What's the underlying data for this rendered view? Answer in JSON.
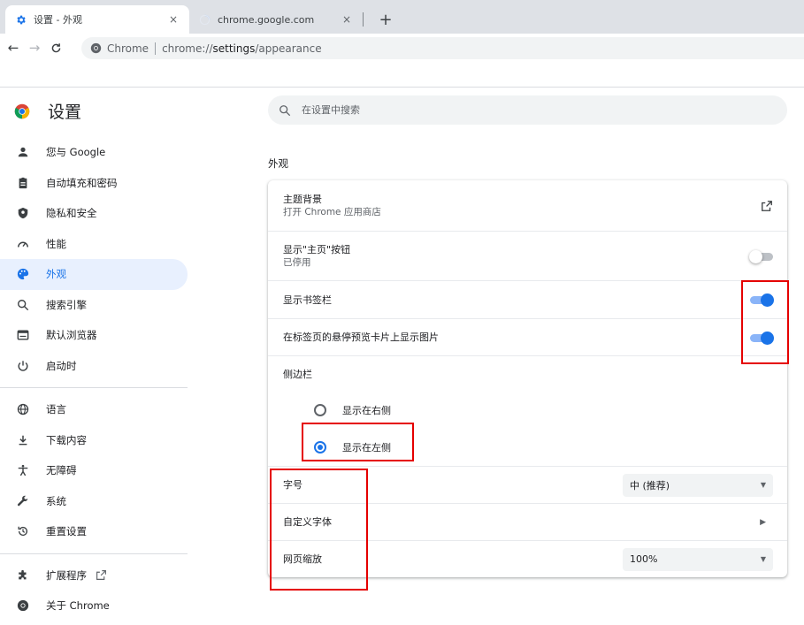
{
  "tabs": [
    {
      "title": "设置 - 外观",
      "active": true
    },
    {
      "title": "chrome.google.com",
      "active": false
    }
  ],
  "tab_close_glyph": "×",
  "new_tab_glyph": "+",
  "toolbar": {
    "back_glyph": "←",
    "forward_glyph": "→",
    "reload_glyph": "C",
    "chip": "Chrome",
    "url_prefix": "chrome://",
    "url_host": "settings",
    "url_path": "/appearance"
  },
  "brand": {
    "title": "设置"
  },
  "nav": {
    "group1": [
      {
        "label": "您与 Google",
        "icon": "person-icon"
      },
      {
        "label": "自动填充和密码",
        "icon": "clipboard-icon"
      },
      {
        "label": "隐私和安全",
        "icon": "shield-icon"
      },
      {
        "label": "性能",
        "icon": "speedometer-icon"
      },
      {
        "label": "外观",
        "icon": "palette-icon",
        "active": true
      },
      {
        "label": "搜索引擎",
        "icon": "search-icon"
      },
      {
        "label": "默认浏览器",
        "icon": "browser-icon"
      },
      {
        "label": "启动时",
        "icon": "power-icon"
      }
    ],
    "group2": [
      {
        "label": "语言",
        "icon": "globe-icon"
      },
      {
        "label": "下载内容",
        "icon": "download-icon"
      },
      {
        "label": "无障碍",
        "icon": "accessibility-icon"
      },
      {
        "label": "系统",
        "icon": "wrench-icon"
      },
      {
        "label": "重置设置",
        "icon": "reset-icon"
      }
    ],
    "group3": [
      {
        "label": "扩展程序",
        "icon": "puzzle-icon"
      },
      {
        "label": "关于 Chrome",
        "icon": "chrome-icon"
      }
    ]
  },
  "search": {
    "placeholder": "在设置中搜索"
  },
  "section": {
    "title": "外观"
  },
  "card": {
    "theme": {
      "title": "主题背景",
      "subtitle": "打开 Chrome 应用商店"
    },
    "home_button": {
      "title": "显示\"主页\"按钮",
      "subtitle": "已停用",
      "enabled": false
    },
    "bookmarks_bar": {
      "title": "显示书签栏",
      "enabled": true
    },
    "hover_preview": {
      "title": "在标签页的悬停预览卡片上显示图片",
      "enabled": true
    },
    "sidebar": {
      "title": "侧边栏",
      "options": [
        {
          "label": "显示在右侧",
          "checked": false
        },
        {
          "label": "显示在左侧",
          "checked": true
        }
      ]
    },
    "font_size": {
      "title": "字号",
      "value": "中 (推荐)"
    },
    "custom_fonts": {
      "title": "自定义字体"
    },
    "page_zoom": {
      "title": "网页缩放",
      "value": "100%"
    }
  },
  "colors": {
    "accent": "#1a73e8",
    "annotation": "#e50000"
  }
}
